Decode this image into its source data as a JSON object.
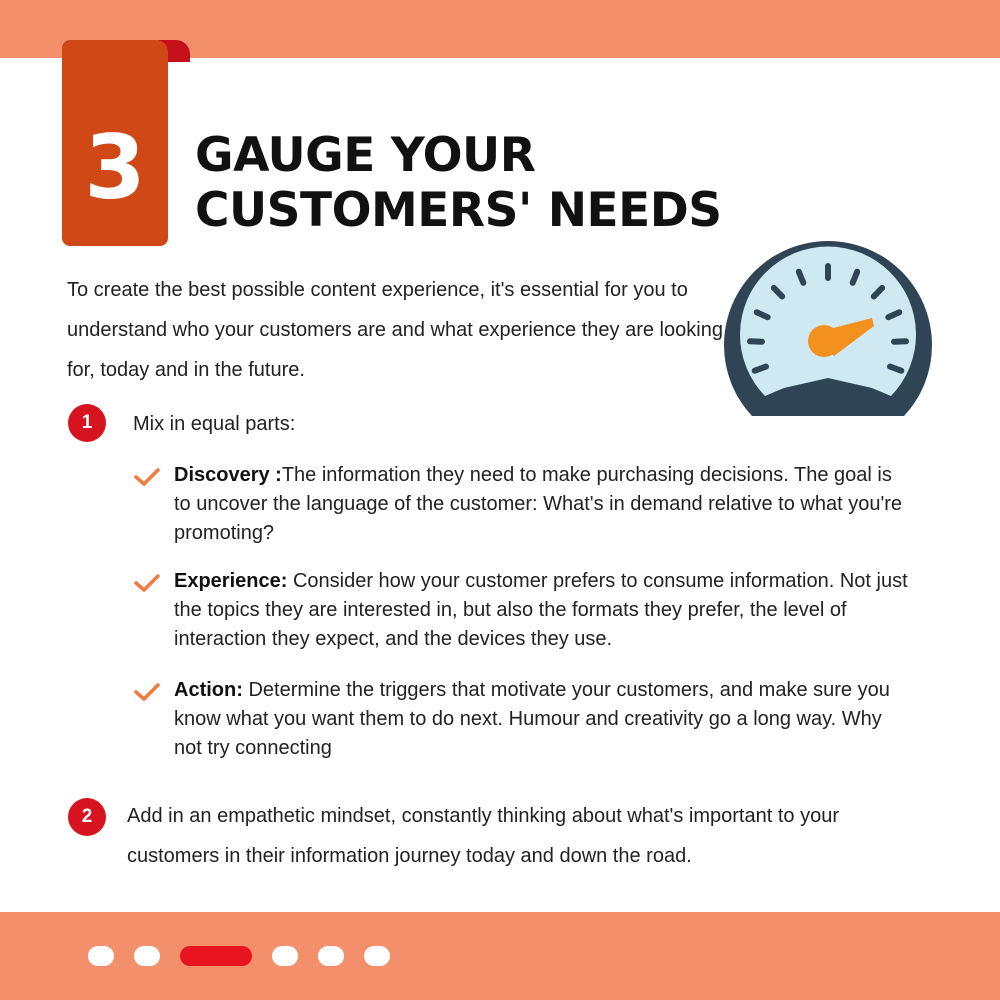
{
  "slide": {
    "number": "3",
    "title_line1": "GAUGE YOUR",
    "title_line2": "CUSTOMERS' NEEDS",
    "intro": "To create the best possible content experience, it's essential for you to understand who your customers are and what experience they are looking for, today and in the future."
  },
  "steps": [
    {
      "badge": "1",
      "text": "Mix in equal parts:"
    },
    {
      "badge": "2",
      "text": "Add in an empathetic mindset, constantly thinking about what's important to your customers in their information journey today and down the road."
    }
  ],
  "checklist": [
    {
      "label": "Discovery :",
      "text": "The information they need to make purchasing decisions. The goal is to uncover the language of the customer: What's in demand relative to what you're promoting?"
    },
    {
      "label": "Experience:",
      "text": " Consider how your customer prefers to consume information. Not just the topics they are interested in, but also the formats they prefer, the level of interaction they expect, and the devices they use."
    },
    {
      "label": "Action:",
      "text": " Determine the triggers that motivate your customers, and make sure you know what you want them to do next. Humour and creativity go a long way. Why not try connecting"
    }
  ],
  "icons": {
    "gauge": "speedometer-icon",
    "check": "check-icon"
  },
  "colors": {
    "band": "#f48f6c",
    "ribbon": "#d04815",
    "badge": "#d6131e",
    "check": "#f07a3f",
    "active_dot": "#e8141f",
    "gauge_dark": "#2f4556",
    "gauge_face": "#cfe9f2",
    "gauge_needle": "#f2911e"
  },
  "pagination": {
    "total": 6,
    "active_index": 2
  }
}
